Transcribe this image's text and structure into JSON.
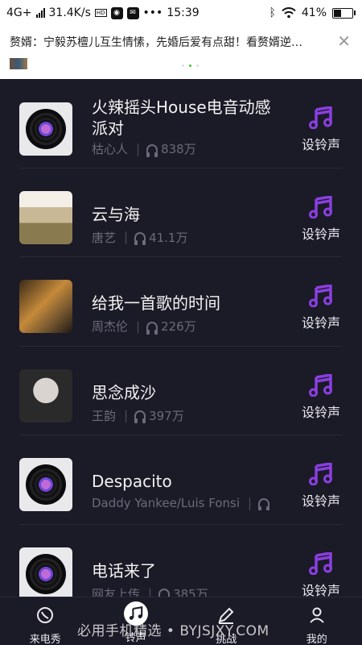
{
  "status_bar": {
    "network": "4G+",
    "speed": "31.4K/s",
    "hd_badge": "HD",
    "time": "15:39",
    "battery": "41%",
    "battery_level": 0.41
  },
  "notification": {
    "text": "赘婿：宁毅苏檀儿互生情愫，先婚后爱有点甜！看赘婿逆…",
    "close_icon": "close-icon"
  },
  "songs": [
    {
      "title": "火辣摇头House电音动感派对",
      "artist": "枯心人",
      "plays": "838万",
      "action": "设铃声",
      "cover": "vinyl"
    },
    {
      "title": "云与海",
      "artist": "唐艺",
      "plays": "41.1万",
      "action": "设铃声",
      "cover": "photo"
    },
    {
      "title": "给我一首歌的时间",
      "artist": "周杰伦",
      "plays": "226万",
      "action": "设铃声",
      "cover": "photo"
    },
    {
      "title": "思念成沙",
      "artist": "王韵",
      "plays": "397万",
      "action": "设铃声",
      "cover": "photo"
    },
    {
      "title": "Despacito",
      "artist": "Daddy Yankee/Luis Fonsi",
      "plays": "",
      "action": "设铃声",
      "cover": "vinyl"
    },
    {
      "title": "电话来了",
      "artist": "网友上传",
      "plays": "385万",
      "action": "设铃声",
      "cover": "vinyl"
    }
  ],
  "tabs": [
    {
      "label": "来电秀",
      "icon": "call-show-icon"
    },
    {
      "label": "铃声",
      "icon": "music-note-icon",
      "active": true
    },
    {
      "label": "挑战",
      "icon": "pen-icon"
    },
    {
      "label": "我的",
      "icon": "profile-icon"
    }
  ],
  "watermark": "必用手机精选 • BYJSJXY.COM",
  "colors": {
    "accent": "#8a3fe0",
    "background": "#1b1a27"
  }
}
